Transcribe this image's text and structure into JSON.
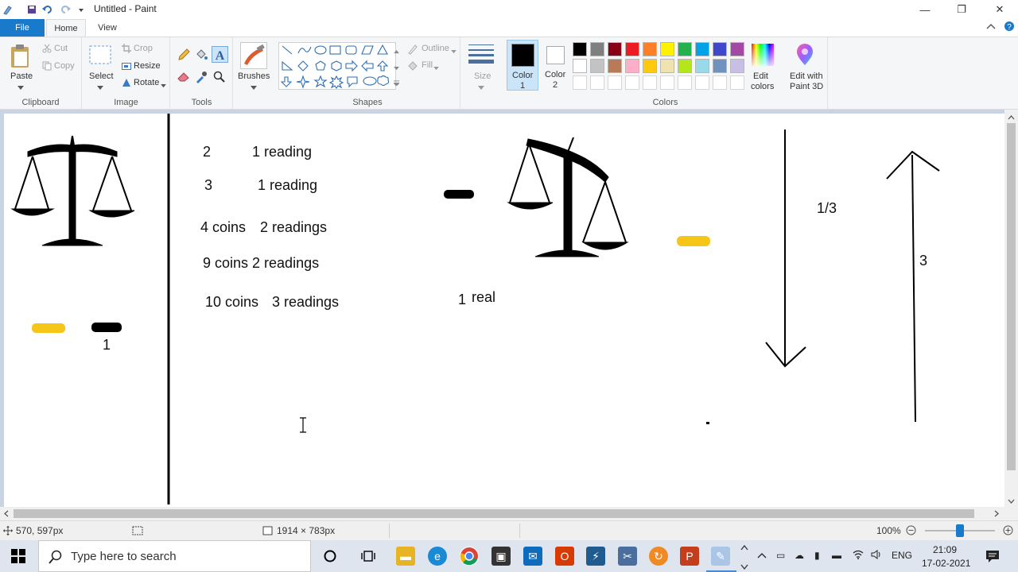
{
  "window": {
    "title": "Untitled - Paint",
    "controls": {
      "minimize": "—",
      "maximize": "❐",
      "close": "✕"
    }
  },
  "ribbon_tabs": [
    "File",
    "Home",
    "View"
  ],
  "ribbon": {
    "clipboard": {
      "paste": "Paste",
      "cut": "Cut",
      "copy": "Copy",
      "group": "Clipboard"
    },
    "image": {
      "select": "Select",
      "crop": "Crop",
      "resize": "Resize",
      "rotate": "Rotate",
      "group": "Image"
    },
    "tools": {
      "group": "Tools"
    },
    "brushes": {
      "label": "Brushes"
    },
    "shapes": {
      "outline": "Outline",
      "fill": "Fill",
      "group": "Shapes"
    },
    "size": {
      "label": "Size"
    },
    "colors": {
      "color1_label": "Color",
      "color1_num": "1",
      "color2_label": "Color",
      "color2_num": "2",
      "group": "Colors",
      "edit_colors_1": "Edit",
      "edit_colors_2": "colors",
      "edit_paint3d_1": "Edit with",
      "edit_paint3d_2": "Paint 3D",
      "palette_row1": [
        "#000000",
        "#7f7f7f",
        "#880015",
        "#ed1c24",
        "#ff7f27",
        "#fff200",
        "#22b14c",
        "#00a2e8",
        "#3f48cc",
        "#a349a4"
      ],
      "palette_row2": [
        "#ffffff",
        "#c3c3c3",
        "#b97a57",
        "#ffaec9",
        "#ffc90e",
        "#efe4b0",
        "#b5e61d",
        "#99d9ea",
        "#7092be",
        "#c8bfe7"
      ],
      "color1": "#000000",
      "color2": "#ffffff"
    }
  },
  "canvas": {
    "texts": {
      "n2": "2",
      "r1": "1 reading",
      "n3": "3",
      "r2": "1 reading",
      "c4": "4 coins",
      "r4": "2 readings",
      "c9": "9 coins 2 readings",
      "c10": "10 coins",
      "r10": "3 readings",
      "real_1": "1",
      "real": "real",
      "left_1": "1",
      "frac": "1/3",
      "three": "3"
    }
  },
  "status": {
    "cursor_pos": "570, 597px",
    "canvas_size": "1914 × 783px",
    "zoom": "100%"
  },
  "taskbar": {
    "search_placeholder": "Type here to search",
    "language": "ENG",
    "time": "21:09",
    "date": "17-02-2021"
  }
}
